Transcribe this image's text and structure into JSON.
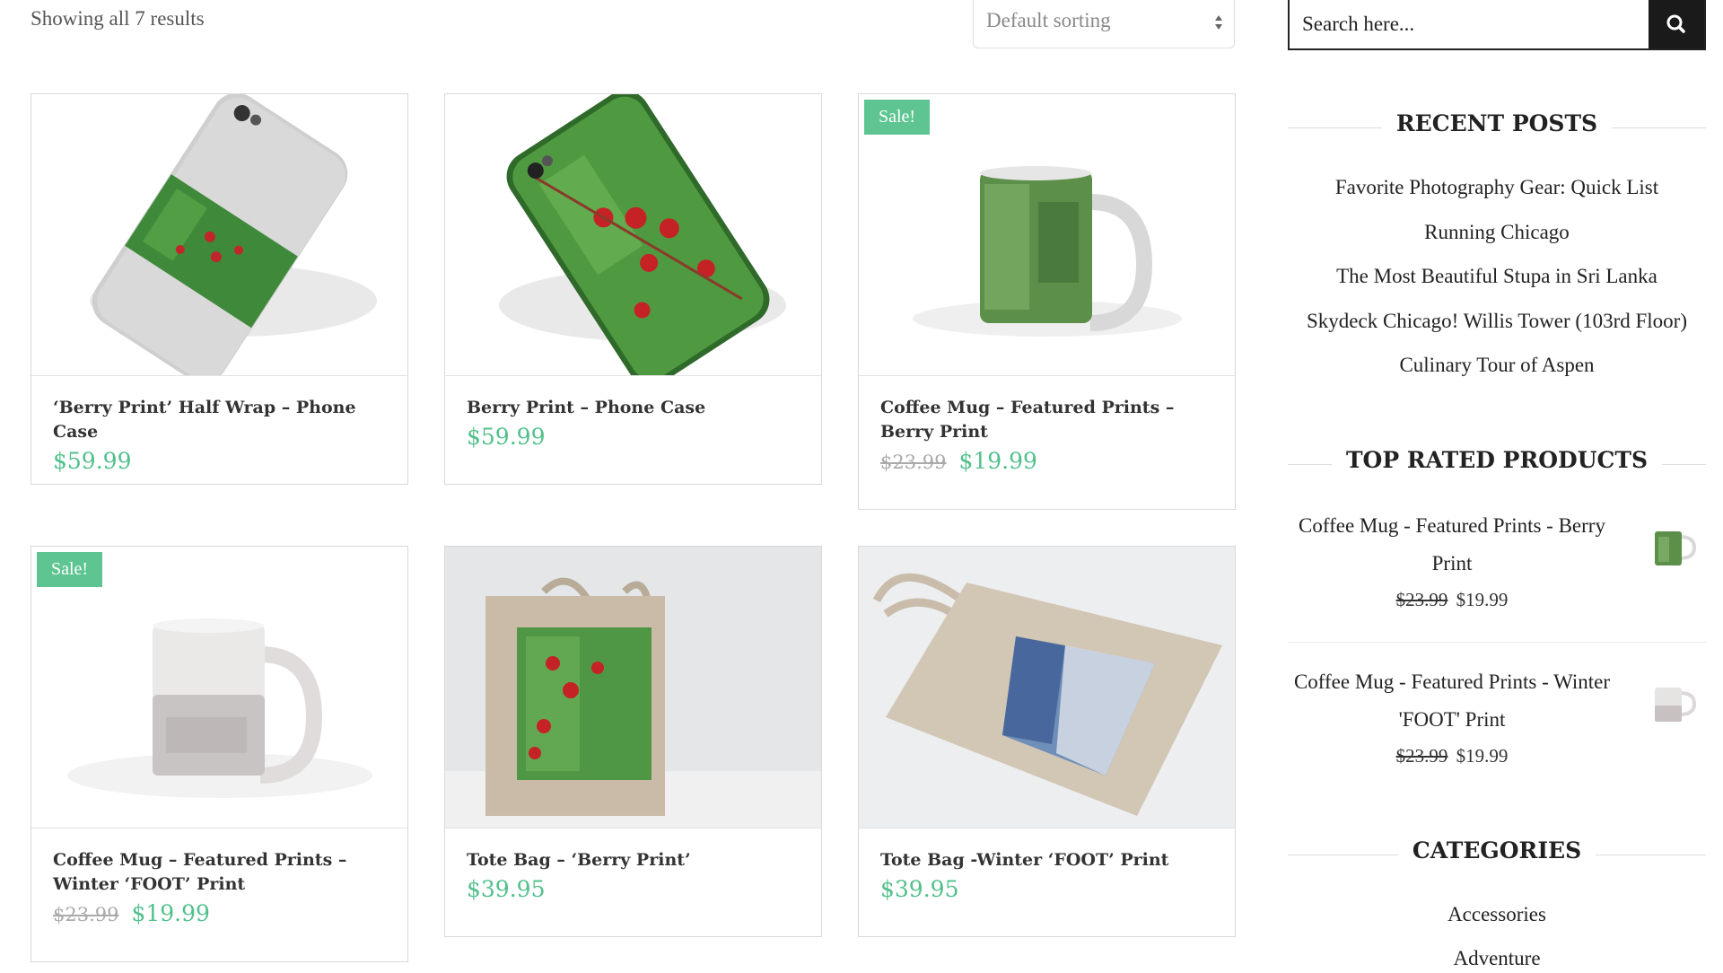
{
  "toolbar": {
    "result_count": "Showing all 7 results",
    "sorting_selected": "Default sorting"
  },
  "products": [
    {
      "title": "‘Berry Print’ Half Wrap – Phone Case",
      "price": "$59.99",
      "sale": false
    },
    {
      "title": "Berry Print – Phone Case",
      "price": "$59.99",
      "sale": false
    },
    {
      "title": "Coffee Mug – Featured Prints – Berry Print",
      "old_price": "$23.99",
      "price": "$19.99",
      "sale": true,
      "sale_label": "Sale!"
    },
    {
      "title": "Coffee Mug – Featured Prints – Winter ‘FOOT’ Print",
      "old_price": "$23.99",
      "price": "$19.99",
      "sale": true,
      "sale_label": "Sale!"
    },
    {
      "title": "Tote Bag – ‘Berry Print’",
      "price": "$39.95",
      "sale": false
    },
    {
      "title": "Tote Bag -Winter ‘FOOT’ Print",
      "price": "$39.95",
      "sale": false
    }
  ],
  "sidebar": {
    "search_placeholder": "Search here...",
    "search_icon": "search-icon",
    "recent_posts": {
      "title": "RECENT POSTS",
      "items": [
        "Favorite Photography Gear: Quick List",
        "Running Chicago",
        "The Most Beautiful Stupa in Sri Lanka",
        "Skydeck Chicago! Willis Tower (103rd Floor)",
        "Culinary Tour of Aspen"
      ]
    },
    "top_rated": {
      "title": "TOP RATED PRODUCTS",
      "items": [
        {
          "title": "Coffee Mug - Featured Prints - Berry Print",
          "old_price": "$23.99",
          "price": "$19.99"
        },
        {
          "title": "Coffee Mug - Featured Prints - Winter 'FOOT' Print",
          "old_price": "$23.99",
          "price": "$19.99"
        }
      ]
    },
    "categories": {
      "title": "CATEGORIES",
      "items": [
        "Accessories",
        "Adventure"
      ]
    }
  },
  "colors": {
    "accent_green": "#52c08b",
    "sale_badge": "#5ec592",
    "search_button": "#1a1a1a"
  }
}
